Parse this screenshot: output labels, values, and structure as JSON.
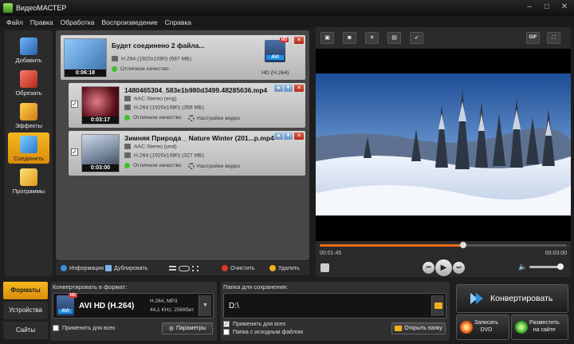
{
  "window": {
    "title": "ВидеоМАСТЕР",
    "controls": [
      "–",
      "□",
      "✕"
    ]
  },
  "menu": [
    "Файл",
    "Правка",
    "Обработка",
    "Воспроизведение",
    "Справка"
  ],
  "left_tools": [
    "Добавить",
    "Обрезать",
    "Эффекты",
    "Соединить",
    "Программы"
  ],
  "files": {
    "merged": {
      "title": "Будет соединено 2 файла...",
      "codec": "H.264 (1920x1080) (687 МБ)",
      "quality": "Отличное качество",
      "duration": "0:06:18",
      "format_badge": "HD (H.264)",
      "format_icon_text": "AVI",
      "hd_tag": "HD"
    },
    "items": [
      {
        "name": "1480465304_583e1b980d3499.48285636.mp4",
        "audio": "AAC Stereo (eng)",
        "codec": "H.264 (1920x1080) (358 МБ)",
        "quality": "Отличное качество",
        "settings": "Настройки видео",
        "duration": "0:03:17",
        "checked": "✓"
      },
      {
        "name": "Зимняя Природа _ Nature Winter (201...p.mp4",
        "audio": "AAC Stereo (und)",
        "codec": "H.264 (1920x1080) (327 МБ)",
        "quality": "Отличное качество",
        "settings": "Настройки видео",
        "duration": "0:03:00",
        "checked": "✓"
      }
    ]
  },
  "list_toolbar": {
    "info": "Информация",
    "duplicate": "Дублировать",
    "clear": "Очистить",
    "delete": "Удалить"
  },
  "player": {
    "tools": [
      "gif-icon"
    ],
    "gif_label": "GIF",
    "current_time": "00:01:45",
    "end_time": "00:03:00",
    "progress": 0.58,
    "volume": 1.0
  },
  "bottom_tabs": [
    "Форматы",
    "Устройства",
    "Сайты"
  ],
  "format": {
    "label": "Конвертировать в формат:",
    "name": "AVI HD (H.264)",
    "spec1": "H.264, MP3",
    "spec2": "44,1 KHz, 256Кбит",
    "apply_all": "Применить для всех",
    "params_button": "Параметры",
    "icon_text": "AVI",
    "hd_tag": "HD"
  },
  "folder": {
    "label": "Папка для сохранения:",
    "path": "D:\\",
    "apply_all": "Применить для всех",
    "source_folder": "Папка с исходным файлом",
    "open_button": "Открыть папку",
    "apply_checked": "✓"
  },
  "actions": {
    "convert": "Конвертировать",
    "burn_line1": "Записать",
    "burn_line2": "DVD",
    "share_line1": "Разместить",
    "share_line2": "на сайте"
  },
  "colors": {
    "accent": "#f0a818",
    "timeline": "#f06c1a",
    "quality_ok": "#3fbf2a"
  }
}
